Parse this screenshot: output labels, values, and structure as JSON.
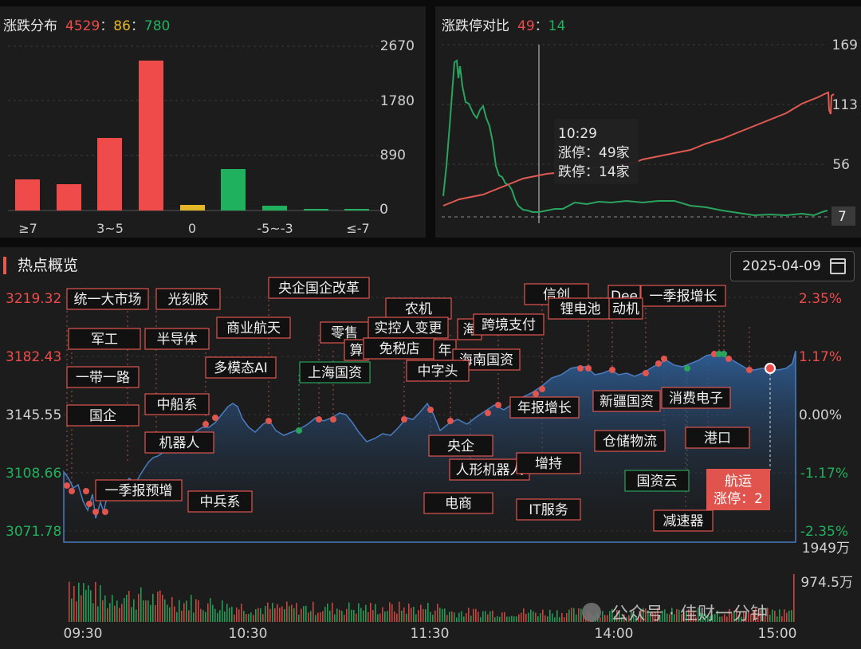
{
  "distribution": {
    "title": "涨跌分布",
    "up": "4529",
    "flat": "86",
    "down": "780",
    "sep": "：",
    "y_ticks": [
      "2670",
      "1780",
      "890",
      "0"
    ],
    "x_labels": [
      "≥7",
      "3~5",
      "0",
      "-5~-3",
      "≤-7"
    ]
  },
  "limit": {
    "title": "涨跌停对比",
    "up": "49",
    "down": "14",
    "sep": "：",
    "y_ticks": [
      "169",
      "113",
      "56"
    ],
    "current_down": "7",
    "tooltip": {
      "time": "10:29",
      "up_line": "涨停：49家",
      "down_line": "跌停：14家"
    }
  },
  "hot": {
    "title": "热点概览",
    "date": "2025-04-09",
    "left_ticks": [
      "3219.32",
      "3182.43",
      "3145.55",
      "3108.66",
      "3071.78"
    ],
    "right_ticks": [
      "2.35%",
      "1.17%",
      "0.00%",
      "-1.17%",
      "-2.35%"
    ],
    "vol_ticks": [
      "1949万",
      "974.5万"
    ],
    "time_labels": [
      "09:30",
      "10:30",
      "11:30",
      "14:00",
      "15:00"
    ],
    "watermark": "公众号 · 佳财一分钟",
    "highlight": {
      "name": "航运",
      "detail": "涨停：2"
    },
    "tags": [
      "统一大市场",
      "光刻胶",
      "央企国企改革",
      "农机",
      "信创",
      "Dee",
      "一季报增长",
      "锂电池",
      "动机",
      "军工",
      "半导体",
      "商业航天",
      "零售",
      "实控人变更",
      "海",
      "跨境支付",
      "算",
      "免税店",
      "年",
      "海南国资",
      "一带一路",
      "多模态AI",
      "上海国资",
      "中字头",
      "国企",
      "中船系",
      "新疆国资",
      "消费电子",
      "机器人",
      "年报增长",
      "央企",
      "仓储物流",
      "港口",
      "人形机器人",
      "增持",
      "国资云",
      "一季报预增",
      "中兵系",
      "电商",
      "IT服务",
      "减速器"
    ]
  },
  "colors": {
    "up": "#ef4b4b",
    "flat": "#e3b728",
    "down": "#21b15e",
    "area_top": "#2f5f98"
  }
}
